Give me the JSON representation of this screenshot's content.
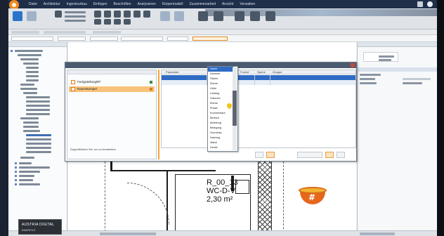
{
  "dialog": {
    "list": [
      {
        "label": "Fertigstellung/Rf",
        "active": false
      },
      {
        "label": "Raumstempel",
        "active": true
      }
    ],
    "hint": "Doppelklicken Sie, um zu bearbeiten"
  },
  "grid": {
    "headers": [
      "Parameter",
      "Wert",
      "Formel",
      "Sperre",
      "Gruppe"
    ],
    "rows": []
  },
  "dropdown": {
    "items": [
      "Name",
      "Nummer",
      "Fläche",
      "Ebene",
      "Höhe",
      "Umfang",
      "Volumen",
      "Ebene",
      "Phase",
      "Kommentare",
      "Bereich",
      "Abteilung",
      "Belegung",
      "Grundriss",
      "Nutzung",
      "Wand",
      "Decke",
      "Boden",
      "Typ"
    ],
    "selected_index": 0
  },
  "room": {
    "name": "R_00_13",
    "type": "WC-D-V",
    "area": "2,30 m²"
  },
  "badge": {
    "line1": "AUSTRIA DIGITAL",
    "line2": "BIM/REVIT"
  },
  "menu": [
    "Datei",
    "Architektur",
    "Ingenieurbau",
    "Einfügen",
    "Beschriften",
    "Analysieren",
    "Körpermodell",
    "Zusammenarbeit",
    "Ansicht",
    "Verwalten"
  ],
  "colors": {
    "accent": "#f28a1c",
    "select_blue": "#2e6bc4",
    "title_bar": "#1f2f4a"
  }
}
